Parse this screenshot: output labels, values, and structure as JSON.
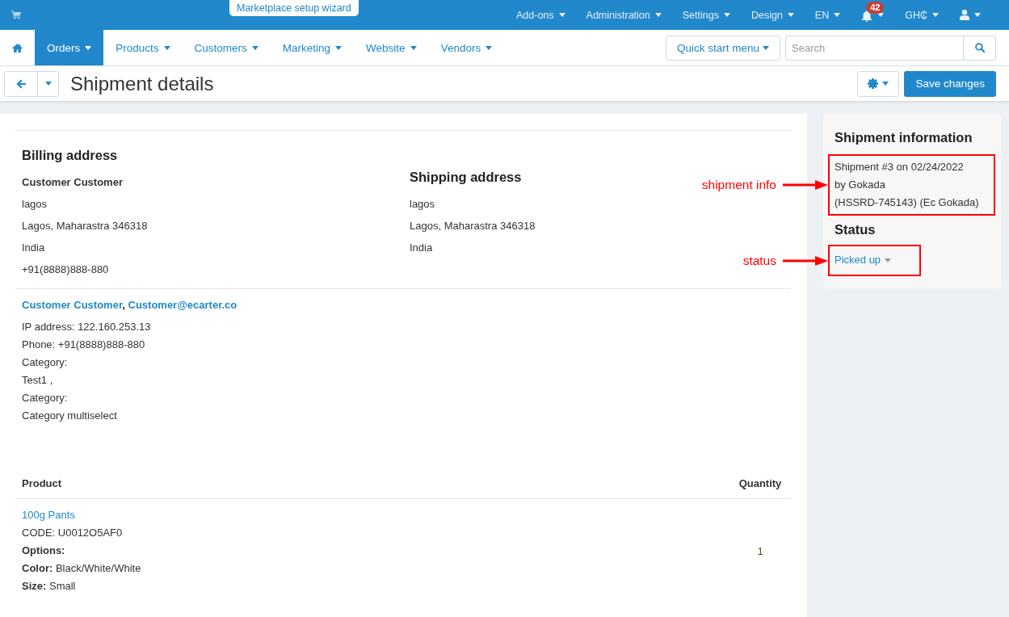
{
  "top_bar": {
    "wizard_link": "Marketplace setup wizard",
    "menus": [
      {
        "kind": "text",
        "label": "Add-ons"
      },
      {
        "kind": "text",
        "label": "Administration"
      },
      {
        "kind": "text",
        "label": "Settings"
      },
      {
        "kind": "text",
        "label": "Design"
      },
      {
        "kind": "text",
        "label": "EN"
      },
      {
        "kind": "notifications",
        "badge": "42"
      },
      {
        "kind": "text",
        "label": "GH₵"
      },
      {
        "kind": "account"
      }
    ]
  },
  "nav": {
    "items": [
      {
        "kind": "home",
        "selected": false
      },
      {
        "kind": "menu",
        "label": "Orders",
        "selected": true
      },
      {
        "kind": "menu",
        "label": "Products",
        "selected": false
      },
      {
        "kind": "menu",
        "label": "Customers",
        "selected": false
      },
      {
        "kind": "menu",
        "label": "Marketing",
        "selected": false
      },
      {
        "kind": "menu",
        "label": "Website",
        "selected": false
      },
      {
        "kind": "menu",
        "label": "Vendors",
        "selected": false
      }
    ],
    "quick_start": "Quick start menu",
    "search": {
      "placeholder": "Search"
    }
  },
  "header": {
    "title": "Shipment details",
    "save_button": "Save changes"
  },
  "billing_address": {
    "heading": "Billing address",
    "name": "Customer Customer",
    "lines": [
      "lagos",
      "Lagos, Maharastra 346318",
      "India",
      "+91(8888)888-880"
    ]
  },
  "shipping_address": {
    "heading": "Shipping address",
    "lines": [
      "lagos",
      "Lagos, Maharastra 346318",
      "India"
    ]
  },
  "customer": {
    "name": "Customer Customer",
    "separator": ",",
    "email": "Customer@ecarter.co",
    "details": [
      "IP address: 122.160.253.13",
      "Phone: +91(8888)888-880",
      "Category:",
      "Test1 ,",
      "Category:",
      "Category multiselect"
    ]
  },
  "products": {
    "columns": [
      "Product",
      "Quantity"
    ],
    "rows": [
      {
        "name": "100g Pants",
        "code": "CODE: U0012O5AF0",
        "options_label": "Options:",
        "options": [
          "**Color:** Black/White/White",
          "**Size:** Small"
        ],
        "quantity": "1"
      }
    ]
  },
  "sidebar": {
    "title": "Shipment information",
    "info": [
      "Shipment #3 on 02/24/2022",
      "by Gokada",
      "(HSSRD-745143) (Ec Gokada)"
    ],
    "info_callout": "shipment info",
    "status_heading": "Status",
    "status": "Picked up",
    "status_callout": "status"
  }
}
